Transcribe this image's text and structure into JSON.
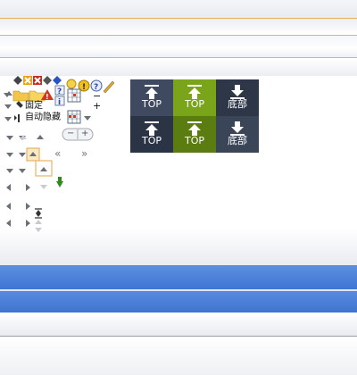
{
  "toolbar": {
    "pin_label": "固定",
    "autohide_label": "自动隐藏",
    "plus": "+",
    "minus": "−",
    "zoom_minus": "−",
    "zoom_plus": "+",
    "nav_back": "«",
    "nav_forward": "»"
  },
  "scroll_buttons": [
    {
      "label": "TOP",
      "icon": "arrow-up-bar-icon",
      "color": "#3f4a60"
    },
    {
      "label": "TOP",
      "icon": "arrow-up-bar-icon",
      "color": "#7aa51a"
    },
    {
      "label": "底部",
      "icon": "arrow-down-bar-icon",
      "color": "#2e3748"
    },
    {
      "label": "TOP",
      "icon": "arrow-up-bar-icon",
      "color": "#2b3445"
    },
    {
      "label": "TOP",
      "icon": "arrow-up-bar-icon",
      "color": "#5a7c10"
    },
    {
      "label": "底部",
      "icon": "arrow-down-bar-icon",
      "color": "#3a4558"
    }
  ],
  "colors": {
    "accent_blue": "#4a80d8",
    "separator_gold": "#e2b661",
    "green_arrow": "#2e8b1e"
  }
}
